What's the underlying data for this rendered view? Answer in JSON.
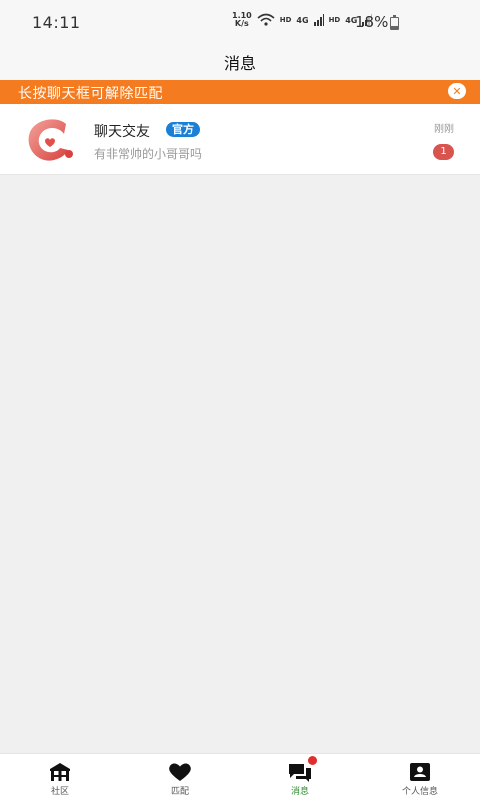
{
  "status_bar": {
    "time": "14:11",
    "net_speed_value": "1.10",
    "net_speed_unit": "K/s",
    "hd1": "HD",
    "sig1": "4G",
    "hd2": "HD",
    "sig2": "4G",
    "battery": "18%"
  },
  "header": {
    "title": "消息"
  },
  "notice": {
    "text": "长按聊天框可解除匹配",
    "close_icon": "close-icon"
  },
  "messages": [
    {
      "name": "聊天交友",
      "badge": "官方",
      "preview": "有非常帅的小哥哥吗",
      "time": "刚刚",
      "unread": "1"
    }
  ],
  "tabs": [
    {
      "label": "社区",
      "icon": "community-icon",
      "active": false
    },
    {
      "label": "匹配",
      "icon": "heart-icon",
      "active": false
    },
    {
      "label": "消息",
      "icon": "chat-icon",
      "active": true
    },
    {
      "label": "个人信息",
      "icon": "profile-icon",
      "active": false
    }
  ],
  "colors": {
    "accent_orange": "#f47b20",
    "official_blue": "#1a7fd6",
    "active_green": "#2e8b2e",
    "badge_red": "#d9534f"
  }
}
